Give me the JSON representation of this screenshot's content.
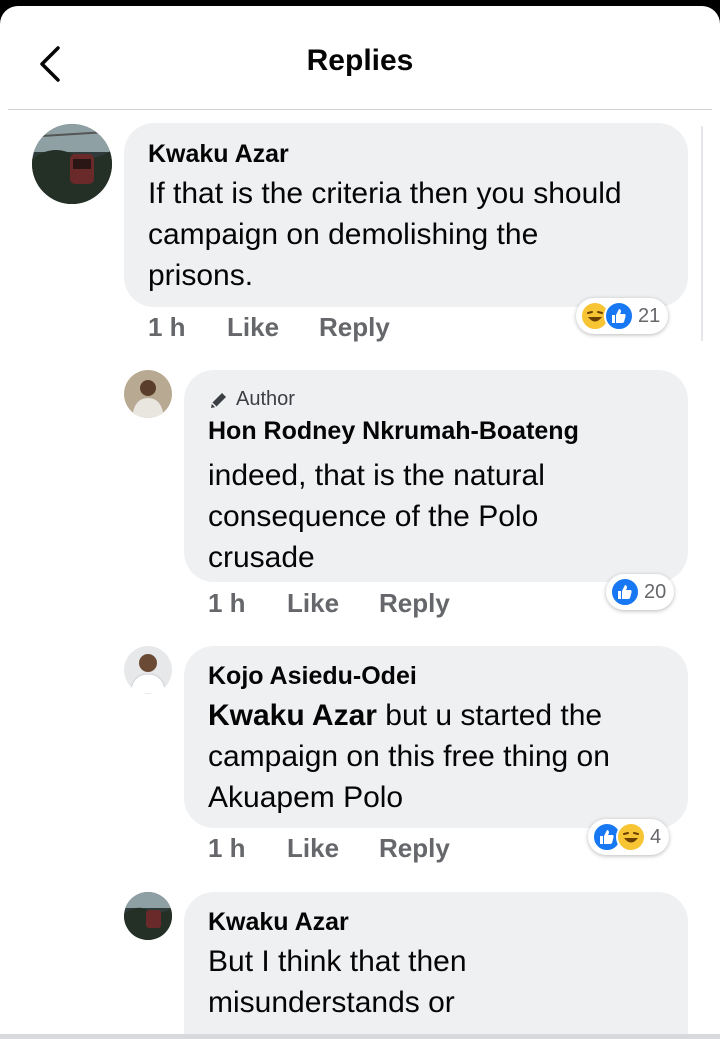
{
  "header": {
    "title": "Replies"
  },
  "comments": [
    {
      "author": "Kwaku Azar",
      "badge": null,
      "lines": [
        "If that is the criteria then you should",
        "campaign on demolishing the",
        "prisons."
      ],
      "time": "1 h",
      "like": "Like",
      "reply": "Reply",
      "reactions": [
        "haha",
        "like"
      ],
      "reaction_count": "21"
    },
    {
      "author": "Hon Rodney Nkrumah-Boateng",
      "badge": "Author",
      "lines": [
        "indeed, that is the natural",
        "consequence of the Polo",
        "crusade"
      ],
      "time": "1 h",
      "like": "Like",
      "reply": "Reply",
      "reactions": [
        "like"
      ],
      "reaction_count": "20"
    },
    {
      "author": "Kojo Asiedu-Odei",
      "badge": null,
      "mention": "Kwaku Azar",
      "lines": [
        " but u started the",
        "campaign on this free thing on",
        "Akuapem Polo"
      ],
      "time": "1 h",
      "like": "Like",
      "reply": "Reply",
      "reactions": [
        "like",
        "haha"
      ],
      "reaction_count": "4"
    },
    {
      "author": "Kwaku Azar",
      "badge": null,
      "lines": [
        "But I think that then",
        "misunderstands or"
      ]
    }
  ],
  "colors": {
    "bubble": "#eff0f2",
    "meta": "#65676b",
    "like": "#1877f2",
    "haha": "#f7c433"
  }
}
